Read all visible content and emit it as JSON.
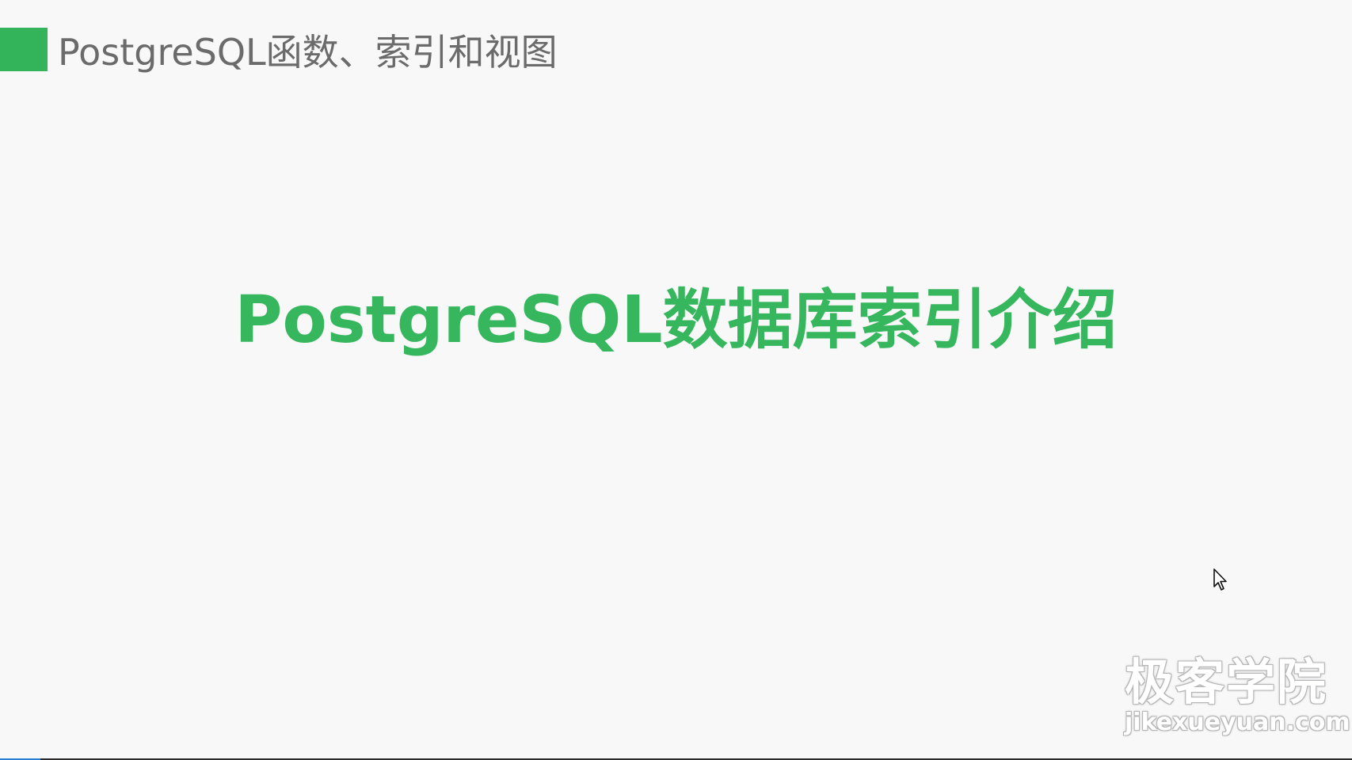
{
  "slide": {
    "header_title": "PostgreSQL函数、索引和视图",
    "main_title": "PostgreSQL数据库索引介绍"
  },
  "watermark": {
    "brand_cn": "极客学院",
    "brand_url": "jikexueyuan.com"
  },
  "colors": {
    "accent_green": "#33b35a",
    "header_text": "#6b6b6b",
    "background": "#f8f8f9"
  },
  "icons": {
    "cursor": "mouse-pointer-icon"
  },
  "progress": {
    "fraction": 0.03
  }
}
